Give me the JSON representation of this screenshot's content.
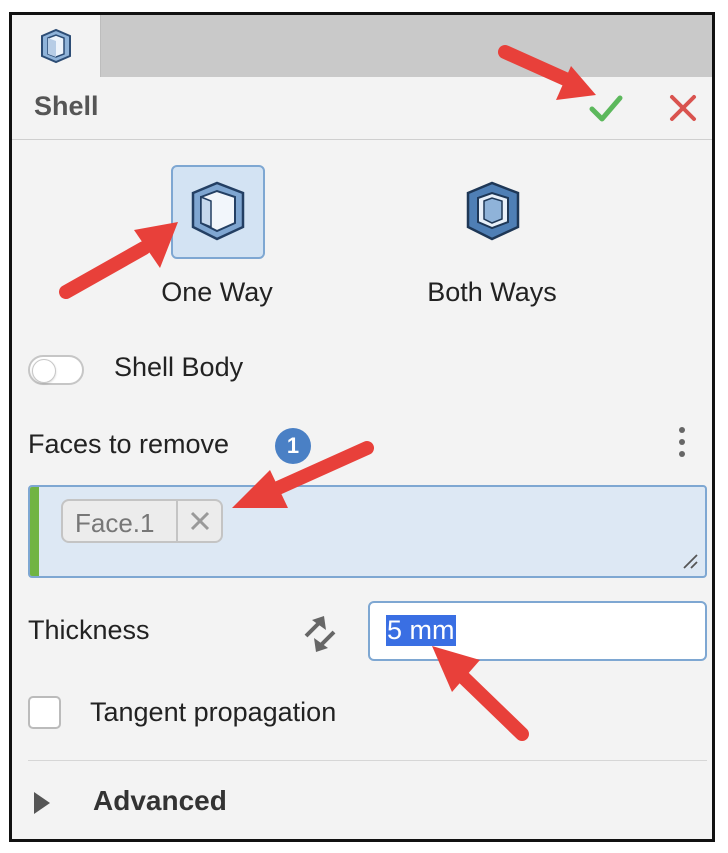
{
  "panel": {
    "title": "Shell",
    "modes": [
      {
        "label": "One Way",
        "selected": true
      },
      {
        "label": "Both Ways",
        "selected": false
      }
    ],
    "shell_body": {
      "label": "Shell Body",
      "on": false
    },
    "faces": {
      "label": "Faces to remove",
      "count": "1",
      "chips": [
        "Face.1"
      ]
    },
    "thickness": {
      "label": "Thickness",
      "value": "5 mm"
    },
    "tangent": {
      "label": "Tangent propagation",
      "checked": false
    },
    "advanced": {
      "label": "Advanced"
    }
  },
  "colors": {
    "accent": "#4a80c5",
    "ok_green": "#5cb85c",
    "cancel_red": "#d9534f",
    "annotation_arrow": "#e8403a",
    "selection_bar": "#71b443"
  }
}
